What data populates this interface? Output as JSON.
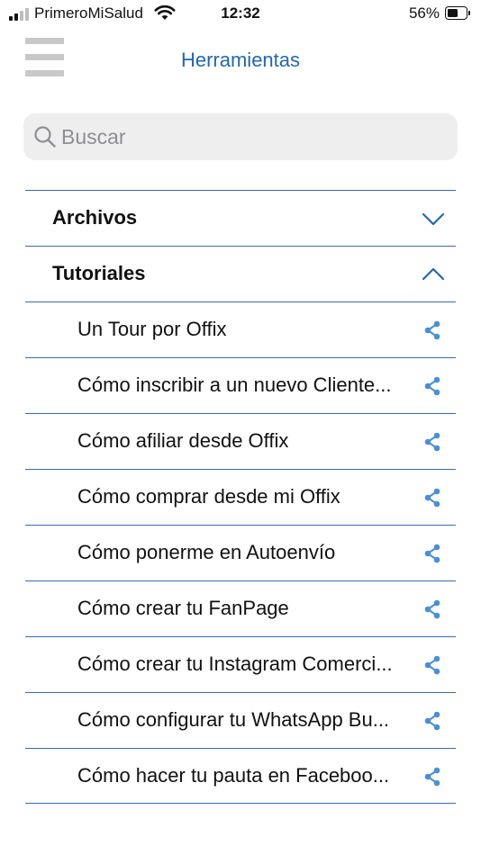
{
  "status_bar": {
    "carrier": "PrimeroMiSalud",
    "time": "12:32",
    "battery": "56%",
    "battery_level": 0.56
  },
  "header": {
    "menu_icon": "hamburger-menu-icon",
    "title": "Herramientas"
  },
  "search": {
    "placeholder": "Buscar",
    "value": "",
    "icon": "search-icon"
  },
  "sections": [
    {
      "label": "Archivos",
      "expanded": false,
      "icon": "chevron-down-icon"
    },
    {
      "label": "Tutoriales",
      "expanded": true,
      "icon": "chevron-up-icon",
      "items": [
        {
          "label": "Un Tour por Offix"
        },
        {
          "label": "Cómo inscribir a un nuevo Cliente..."
        },
        {
          "label": "Cómo afiliar desde Offix"
        },
        {
          "label": "Cómo comprar desde mi Offix"
        },
        {
          "label": "Cómo ponerme en Autoenvío"
        },
        {
          "label": "Cómo crear tu FanPage"
        },
        {
          "label": "Cómo crear tu Instagram Comerci..."
        },
        {
          "label": "Cómo configurar tu WhatsApp Bu..."
        },
        {
          "label": "Cómo hacer tu pauta en Faceboo..."
        }
      ]
    }
  ],
  "colors": {
    "accent": "#2367b1",
    "divider": "#3b6ab0",
    "share_icon": "#4a8fd6",
    "search_bg": "#eeeeef"
  }
}
